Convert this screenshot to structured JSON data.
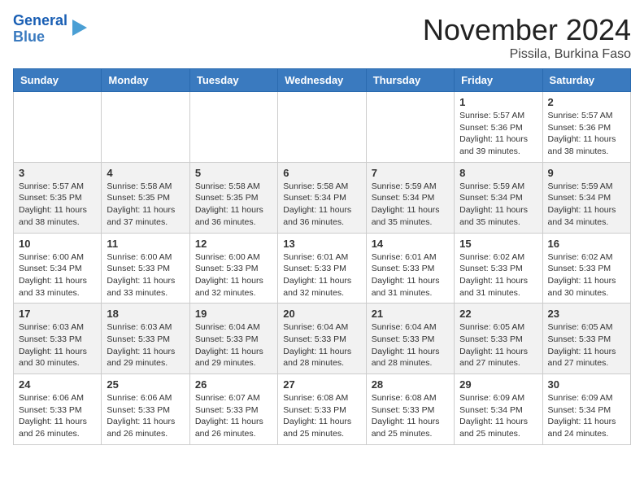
{
  "header": {
    "logo_line1": "General",
    "logo_line2": "Blue",
    "month_title": "November 2024",
    "subtitle": "Pissila, Burkina Faso"
  },
  "days_of_week": [
    "Sunday",
    "Monday",
    "Tuesday",
    "Wednesday",
    "Thursday",
    "Friday",
    "Saturday"
  ],
  "weeks": [
    [
      {
        "day": "",
        "info": ""
      },
      {
        "day": "",
        "info": ""
      },
      {
        "day": "",
        "info": ""
      },
      {
        "day": "",
        "info": ""
      },
      {
        "day": "",
        "info": ""
      },
      {
        "day": "1",
        "info": "Sunrise: 5:57 AM\nSunset: 5:36 PM\nDaylight: 11 hours\nand 39 minutes."
      },
      {
        "day": "2",
        "info": "Sunrise: 5:57 AM\nSunset: 5:36 PM\nDaylight: 11 hours\nand 38 minutes."
      }
    ],
    [
      {
        "day": "3",
        "info": "Sunrise: 5:57 AM\nSunset: 5:35 PM\nDaylight: 11 hours\nand 38 minutes."
      },
      {
        "day": "4",
        "info": "Sunrise: 5:58 AM\nSunset: 5:35 PM\nDaylight: 11 hours\nand 37 minutes."
      },
      {
        "day": "5",
        "info": "Sunrise: 5:58 AM\nSunset: 5:35 PM\nDaylight: 11 hours\nand 36 minutes."
      },
      {
        "day": "6",
        "info": "Sunrise: 5:58 AM\nSunset: 5:34 PM\nDaylight: 11 hours\nand 36 minutes."
      },
      {
        "day": "7",
        "info": "Sunrise: 5:59 AM\nSunset: 5:34 PM\nDaylight: 11 hours\nand 35 minutes."
      },
      {
        "day": "8",
        "info": "Sunrise: 5:59 AM\nSunset: 5:34 PM\nDaylight: 11 hours\nand 35 minutes."
      },
      {
        "day": "9",
        "info": "Sunrise: 5:59 AM\nSunset: 5:34 PM\nDaylight: 11 hours\nand 34 minutes."
      }
    ],
    [
      {
        "day": "10",
        "info": "Sunrise: 6:00 AM\nSunset: 5:34 PM\nDaylight: 11 hours\nand 33 minutes."
      },
      {
        "day": "11",
        "info": "Sunrise: 6:00 AM\nSunset: 5:33 PM\nDaylight: 11 hours\nand 33 minutes."
      },
      {
        "day": "12",
        "info": "Sunrise: 6:00 AM\nSunset: 5:33 PM\nDaylight: 11 hours\nand 32 minutes."
      },
      {
        "day": "13",
        "info": "Sunrise: 6:01 AM\nSunset: 5:33 PM\nDaylight: 11 hours\nand 32 minutes."
      },
      {
        "day": "14",
        "info": "Sunrise: 6:01 AM\nSunset: 5:33 PM\nDaylight: 11 hours\nand 31 minutes."
      },
      {
        "day": "15",
        "info": "Sunrise: 6:02 AM\nSunset: 5:33 PM\nDaylight: 11 hours\nand 31 minutes."
      },
      {
        "day": "16",
        "info": "Sunrise: 6:02 AM\nSunset: 5:33 PM\nDaylight: 11 hours\nand 30 minutes."
      }
    ],
    [
      {
        "day": "17",
        "info": "Sunrise: 6:03 AM\nSunset: 5:33 PM\nDaylight: 11 hours\nand 30 minutes."
      },
      {
        "day": "18",
        "info": "Sunrise: 6:03 AM\nSunset: 5:33 PM\nDaylight: 11 hours\nand 29 minutes."
      },
      {
        "day": "19",
        "info": "Sunrise: 6:04 AM\nSunset: 5:33 PM\nDaylight: 11 hours\nand 29 minutes."
      },
      {
        "day": "20",
        "info": "Sunrise: 6:04 AM\nSunset: 5:33 PM\nDaylight: 11 hours\nand 28 minutes."
      },
      {
        "day": "21",
        "info": "Sunrise: 6:04 AM\nSunset: 5:33 PM\nDaylight: 11 hours\nand 28 minutes."
      },
      {
        "day": "22",
        "info": "Sunrise: 6:05 AM\nSunset: 5:33 PM\nDaylight: 11 hours\nand 27 minutes."
      },
      {
        "day": "23",
        "info": "Sunrise: 6:05 AM\nSunset: 5:33 PM\nDaylight: 11 hours\nand 27 minutes."
      }
    ],
    [
      {
        "day": "24",
        "info": "Sunrise: 6:06 AM\nSunset: 5:33 PM\nDaylight: 11 hours\nand 26 minutes."
      },
      {
        "day": "25",
        "info": "Sunrise: 6:06 AM\nSunset: 5:33 PM\nDaylight: 11 hours\nand 26 minutes."
      },
      {
        "day": "26",
        "info": "Sunrise: 6:07 AM\nSunset: 5:33 PM\nDaylight: 11 hours\nand 26 minutes."
      },
      {
        "day": "27",
        "info": "Sunrise: 6:08 AM\nSunset: 5:33 PM\nDaylight: 11 hours\nand 25 minutes."
      },
      {
        "day": "28",
        "info": "Sunrise: 6:08 AM\nSunset: 5:33 PM\nDaylight: 11 hours\nand 25 minutes."
      },
      {
        "day": "29",
        "info": "Sunrise: 6:09 AM\nSunset: 5:34 PM\nDaylight: 11 hours\nand 25 minutes."
      },
      {
        "day": "30",
        "info": "Sunrise: 6:09 AM\nSunset: 5:34 PM\nDaylight: 11 hours\nand 24 minutes."
      }
    ]
  ]
}
